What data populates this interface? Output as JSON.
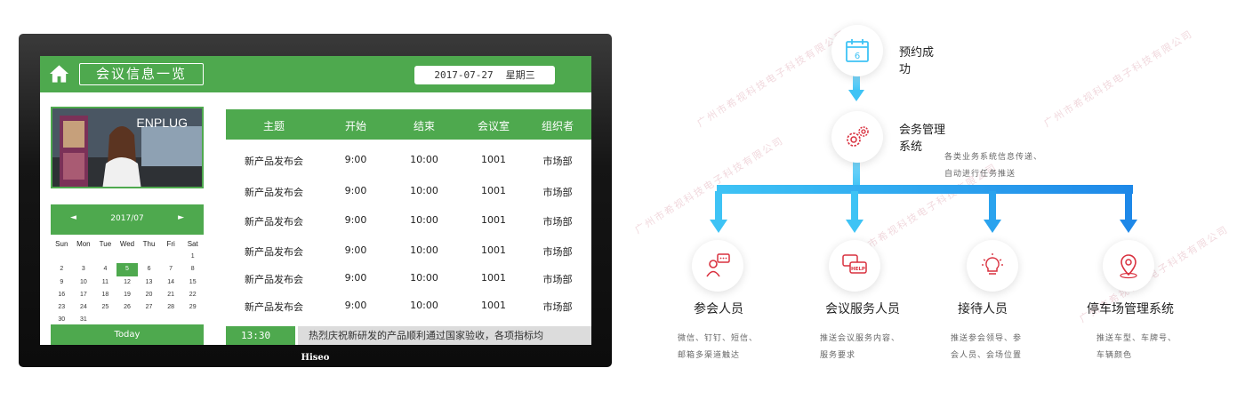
{
  "signage": {
    "title": "会议信息一览",
    "date": "2017-07-27",
    "weekday": "星期三",
    "promo_text": "ENPLUG",
    "brand": "Hiseo",
    "calendar": {
      "month": "2017/07",
      "prev": "◄",
      "next": "►",
      "weekdays": [
        "Sun",
        "Mon",
        "Tue",
        "Wed",
        "Thu",
        "Fri",
        "Sat"
      ],
      "weeks": [
        [
          "",
          "",
          "",
          "",
          "",
          "",
          "1"
        ],
        [
          "2",
          "3",
          "4",
          "5",
          "6",
          "7",
          "8"
        ],
        [
          "9",
          "10",
          "11",
          "12",
          "13",
          "14",
          "15"
        ],
        [
          "16",
          "17",
          "18",
          "19",
          "20",
          "21",
          "22"
        ],
        [
          "23",
          "24",
          "25",
          "26",
          "27",
          "28",
          "29"
        ],
        [
          "30",
          "31",
          "",
          "",
          "",
          "",
          ""
        ]
      ],
      "today_label": "Today"
    },
    "table": {
      "headers": [
        "主题",
        "开始",
        "结束",
        "会议室",
        "组织者"
      ],
      "rows": [
        [
          "新产品发布会",
          "9:00",
          "10:00",
          "1001",
          "市场部"
        ],
        [
          "新产品发布会",
          "9:00",
          "10:00",
          "1001",
          "市场部"
        ],
        [
          "新产品发布会",
          "9:00",
          "10:00",
          "1001",
          "市场部"
        ],
        [
          "新产品发布会",
          "9:00",
          "10:00",
          "1001",
          "市场部"
        ],
        [
          "新产品发布会",
          "9:00",
          "10:00",
          "1001",
          "市场部"
        ],
        [
          "新产品发布会",
          "9:00",
          "10:00",
          "1001",
          "市场部"
        ]
      ]
    },
    "footer": {
      "time": "13:30",
      "marquee": "热烈庆祝新研发的产品顺利通过国家验收，各项指标均"
    },
    "accent": "#4ea94e"
  },
  "diagram": {
    "booking": {
      "label_line1": "预约成",
      "label_line2": "功",
      "icon": "calendar-icon",
      "calendar_day": "6"
    },
    "management": {
      "label_line1": "会务管理",
      "label_line2": "系统",
      "desc_line1": "各类业务系统信息传递、",
      "desc_line2": "自动进行任务推送",
      "icon": "gears-icon"
    },
    "roles": [
      {
        "name": "参会人员",
        "desc_line1": "微信、钉钉、短信、",
        "desc_line2": "邮箱多渠道触达",
        "icon": "attendee-chat-icon"
      },
      {
        "name": "会议服务人员",
        "desc_line1": "推送会议服务内容、",
        "desc_line2": "服务要求",
        "icon": "help-chat-icon"
      },
      {
        "name": "接待人员",
        "desc_line1": "推送参会领导、参",
        "desc_line2": "会人员、会场位置",
        "icon": "lightbulb-icon"
      },
      {
        "name": "停车场管理系统",
        "desc_line1": "推送车型、车牌号、",
        "desc_line2": "车辆颜色",
        "icon": "location-pin-icon"
      }
    ],
    "help_text": "HELP",
    "watermark": "广州市希视科技电子科技有限公司",
    "accent": "#3ec3f5",
    "icon_color": "#d9313f"
  }
}
